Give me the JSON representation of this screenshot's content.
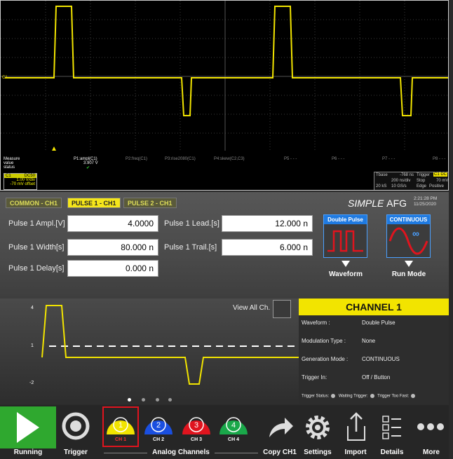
{
  "scope": {
    "measure_label": "Measure",
    "value_label": "value",
    "status_label": "status",
    "measurements": [
      {
        "name": "P1:ampl(C1)",
        "value": "3.907 V",
        "status": "✔"
      },
      {
        "name": "P2:freq(C1)",
        "value": "",
        "status": ""
      },
      {
        "name": "P3:rise2080(C1)",
        "value": "",
        "status": ""
      },
      {
        "name": "P4:skew(C2,C3)",
        "value": "",
        "status": ""
      },
      {
        "name": "P5 - - -",
        "value": "",
        "status": ""
      },
      {
        "name": "P6 - - -",
        "value": "",
        "status": ""
      },
      {
        "name": "P7 - - -",
        "value": "",
        "status": ""
      },
      {
        "name": "P8 - - -",
        "value": "",
        "status": ""
      }
    ],
    "channel": {
      "name": "C1",
      "coupling": "DC50",
      "vdiv": "1.00 V/div",
      "offset": "-70 mV offset"
    },
    "timebase": {
      "tbase_label": "Tbase",
      "tbase_value": "-768 ns",
      "trigger_label": "Trigger",
      "trigger_ch": "C1 DC",
      "row2": [
        "200 ns/div",
        "Stop",
        "70 mV"
      ],
      "row3": [
        "20 kS",
        "10 GS/s",
        "Edge",
        "Positive"
      ]
    }
  },
  "afg": {
    "tabs": [
      "COMMON - CH1",
      "PULSE 1 - CH1",
      "PULSE 2 - CH1"
    ],
    "active_tab": 1,
    "brand_italic": "SIMPLE",
    "brand_rest": "AFG",
    "time": "2:21:28 PM",
    "date": "11/25/2020",
    "params": {
      "ampl_label": "Pulse 1 Ampl.[V]",
      "ampl_value": "4.0000",
      "width_label": "Pulse 1 Width[s]",
      "width_value": "80.000 n",
      "delay_label": "Pulse 1 Delay[s]",
      "delay_value": "0.000 n",
      "lead_label": "Pulse 1 Lead.[s]",
      "lead_value": "12.000 n",
      "trail_label": "Pulse 1 Trail.[s]",
      "trail_value": "6.000 n"
    },
    "waveform_box_title": "Double Pulse",
    "runmode_box_title": "CONTINUOUS",
    "waveform_label": "Waveform",
    "runmode_label": "Run Mode"
  },
  "preview": {
    "view_all_label": "View All Ch.",
    "y_ticks": [
      "4",
      "1",
      "-2"
    ]
  },
  "channel_info": {
    "title": "CHANNEL 1",
    "rows": [
      {
        "label": "Waveform :",
        "value": "Double Pulse"
      },
      {
        "label": "Modulation Type :",
        "value": "None"
      },
      {
        "label": "Generation Mode :",
        "value": "CONTINUOUS"
      },
      {
        "label": "Trigger In:",
        "value": "Off   /   Button"
      }
    ],
    "trigger_status": "Trigger Status:",
    "waiting_trigger": "Waiting Trigger:",
    "trigger_too_fast": "Trigger Too Fast:"
  },
  "toolbar": {
    "running": "Running",
    "trigger": "Trigger",
    "analog_channels": "Analog Channels",
    "channels": [
      {
        "num": "1",
        "label": "CH 1",
        "color": "#f2e400"
      },
      {
        "num": "2",
        "label": "CH 2",
        "color": "#1a4fe0"
      },
      {
        "num": "3",
        "label": "CH 3",
        "color": "#e0141e"
      },
      {
        "num": "4",
        "label": "CH 4",
        "color": "#1aa84a"
      }
    ],
    "copy": "Copy CH1",
    "settings": "Settings",
    "import": "Import",
    "details": "Details",
    "more": "More"
  }
}
